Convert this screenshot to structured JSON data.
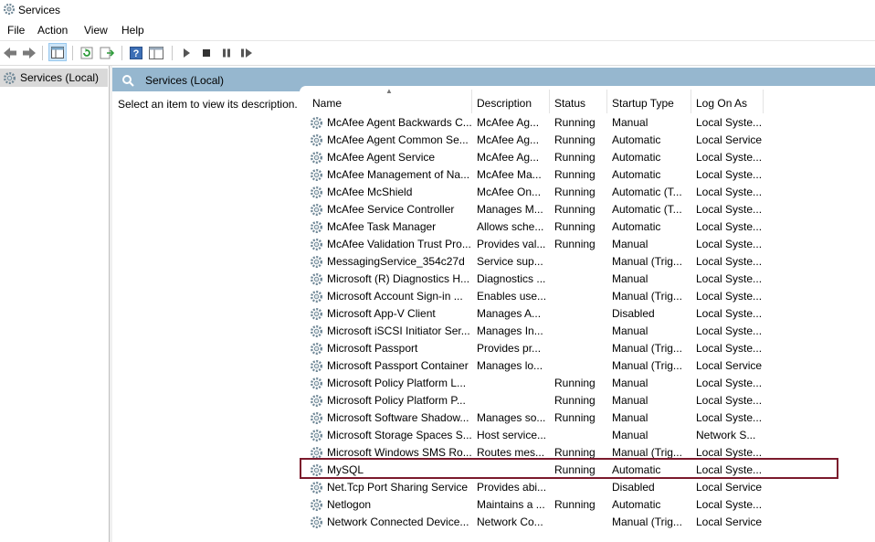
{
  "window": {
    "title": "Services"
  },
  "menu": [
    "File",
    "Action",
    "View",
    "Help"
  ],
  "tree": {
    "item_label": "Services (Local)"
  },
  "pane": {
    "header_title": "Services (Local)",
    "description_text": "Select an item to view its description."
  },
  "columns": [
    "Name",
    "Description",
    "Status",
    "Startup Type",
    "Log On As"
  ],
  "rows": [
    {
      "name": "McAfee Agent Backwards C...",
      "desc": "McAfee Ag...",
      "status": "Running",
      "startup": "Manual",
      "logon": "Local Syste..."
    },
    {
      "name": "McAfee Agent Common Se...",
      "desc": "McAfee Ag...",
      "status": "Running",
      "startup": "Automatic",
      "logon": "Local Service"
    },
    {
      "name": "McAfee Agent Service",
      "desc": "McAfee Ag...",
      "status": "Running",
      "startup": "Automatic",
      "logon": "Local Syste..."
    },
    {
      "name": "McAfee Management of Na...",
      "desc": "McAfee Ma...",
      "status": "Running",
      "startup": "Automatic",
      "logon": "Local Syste..."
    },
    {
      "name": "McAfee McShield",
      "desc": "McAfee On...",
      "status": "Running",
      "startup": "Automatic (T...",
      "logon": "Local Syste..."
    },
    {
      "name": "McAfee Service Controller",
      "desc": "Manages M...",
      "status": "Running",
      "startup": "Automatic (T...",
      "logon": "Local Syste..."
    },
    {
      "name": "McAfee Task Manager",
      "desc": "Allows sche...",
      "status": "Running",
      "startup": "Automatic",
      "logon": "Local Syste..."
    },
    {
      "name": "McAfee Validation Trust Pro...",
      "desc": "Provides val...",
      "status": "Running",
      "startup": "Manual",
      "logon": "Local Syste..."
    },
    {
      "name": "MessagingService_354c27d",
      "desc": "Service sup...",
      "status": "",
      "startup": "Manual (Trig...",
      "logon": "Local Syste..."
    },
    {
      "name": "Microsoft (R) Diagnostics H...",
      "desc": "Diagnostics ...",
      "status": "",
      "startup": "Manual",
      "logon": "Local Syste..."
    },
    {
      "name": "Microsoft Account Sign-in ...",
      "desc": "Enables use...",
      "status": "",
      "startup": "Manual (Trig...",
      "logon": "Local Syste..."
    },
    {
      "name": "Microsoft App-V Client",
      "desc": "Manages A...",
      "status": "",
      "startup": "Disabled",
      "logon": "Local Syste..."
    },
    {
      "name": "Microsoft iSCSI Initiator Ser...",
      "desc": "Manages In...",
      "status": "",
      "startup": "Manual",
      "logon": "Local Syste..."
    },
    {
      "name": "Microsoft Passport",
      "desc": "Provides pr...",
      "status": "",
      "startup": "Manual (Trig...",
      "logon": "Local Syste..."
    },
    {
      "name": "Microsoft Passport Container",
      "desc": "Manages lo...",
      "status": "",
      "startup": "Manual (Trig...",
      "logon": "Local Service"
    },
    {
      "name": "Microsoft Policy Platform L...",
      "desc": "",
      "status": "Running",
      "startup": "Manual",
      "logon": "Local Syste..."
    },
    {
      "name": "Microsoft Policy Platform P...",
      "desc": "",
      "status": "Running",
      "startup": "Manual",
      "logon": "Local Syste..."
    },
    {
      "name": "Microsoft Software Shadow...",
      "desc": "Manages so...",
      "status": "Running",
      "startup": "Manual",
      "logon": "Local Syste..."
    },
    {
      "name": "Microsoft Storage Spaces S...",
      "desc": "Host service...",
      "status": "",
      "startup": "Manual",
      "logon": "Network S..."
    },
    {
      "name": "Microsoft Windows SMS Ro...",
      "desc": "Routes mes...",
      "status": "Running",
      "startup": "Manual (Trig...",
      "logon": "Local Syste..."
    },
    {
      "name": "MySQL",
      "desc": "",
      "status": "Running",
      "startup": "Automatic",
      "logon": "Local Syste..."
    },
    {
      "name": "Net.Tcp Port Sharing Service",
      "desc": "Provides abi...",
      "status": "",
      "startup": "Disabled",
      "logon": "Local Service"
    },
    {
      "name": "Netlogon",
      "desc": "Maintains a ...",
      "status": "Running",
      "startup": "Automatic",
      "logon": "Local Syste..."
    },
    {
      "name": "Network Connected Device...",
      "desc": "Network Co...",
      "status": "",
      "startup": "Manual (Trig...",
      "logon": "Local Service"
    }
  ],
  "colors": {
    "pane_header": "#96b7cf",
    "highlight_border": "#7b1a2c",
    "tree_selected": "#d9d9d9"
  },
  "icons": [
    "services-gear-icon",
    "back-arrow-icon",
    "forward-arrow-icon",
    "show-hide-tree-icon",
    "refresh-icon",
    "export-list-icon",
    "help-icon",
    "properties-icon",
    "start-icon",
    "stop-icon",
    "pause-icon",
    "restart-icon"
  ]
}
